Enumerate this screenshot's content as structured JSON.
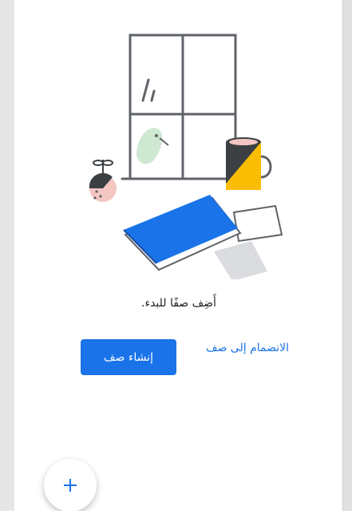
{
  "empty_state": {
    "message": "أَضِف صفًا للبدء.",
    "join_label": "الانضمام إلى صف",
    "create_label": "إنشاء صف"
  },
  "fab": {
    "icon": "plus-icon"
  },
  "colors": {
    "accent": "#1a73e8",
    "mug_yellow": "#fbbc04",
    "mug_dark": "#3c4043",
    "notebook_blue": "#1a73e8",
    "bird_green": "#cfe8d2",
    "fruit_pink": "#f4c7c3"
  }
}
